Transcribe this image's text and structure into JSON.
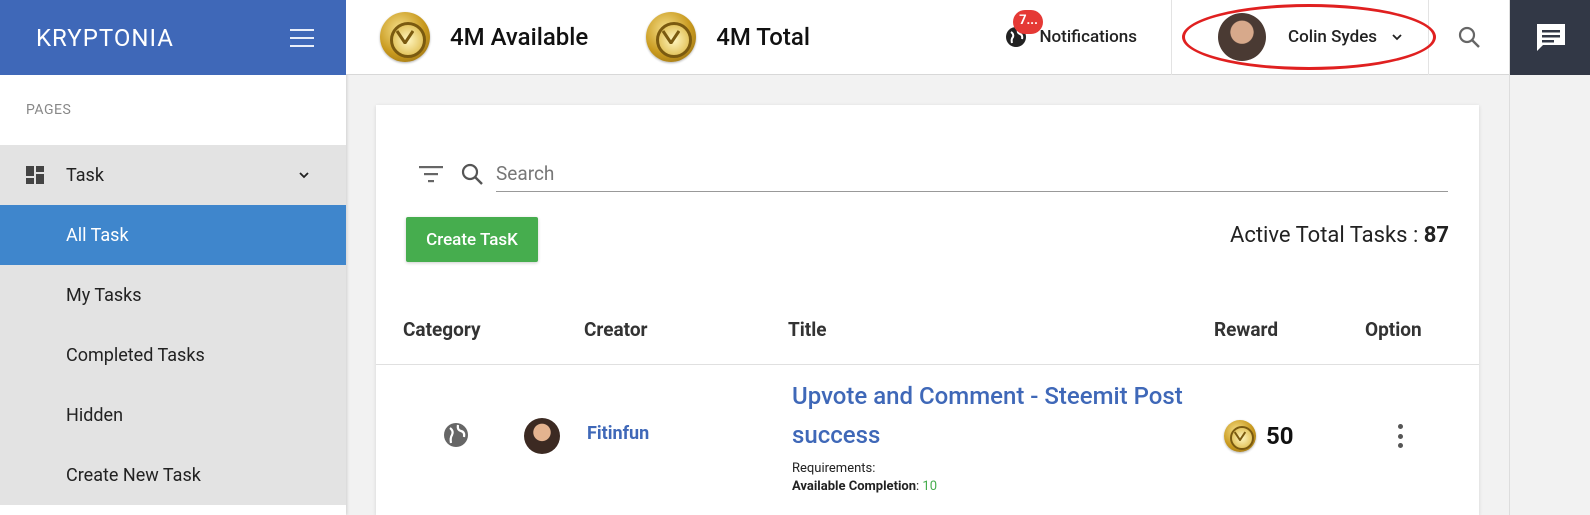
{
  "sidebar": {
    "brand": "KRYPTONIA",
    "section_label": "PAGES",
    "parent_item": {
      "label": "Task",
      "icon": "dashboard-icon"
    },
    "items": [
      {
        "label": "All Task",
        "active": true
      },
      {
        "label": "My Tasks",
        "active": false
      },
      {
        "label": "Completed Tasks",
        "active": false
      },
      {
        "label": "Hidden",
        "active": false
      },
      {
        "label": "Create New Task",
        "active": false
      }
    ]
  },
  "topbar": {
    "available": "4M Available",
    "total": "4M Total",
    "notifications_label": "Notifications",
    "notifications_badge": "7...",
    "user_name": "Colin Sydes"
  },
  "main": {
    "search_placeholder": "Search",
    "create_button": "Create TasK",
    "active_total_label": "Active Total Tasks : ",
    "active_total_value": "87",
    "columns": [
      "Category",
      "Creator",
      "Title",
      "Reward",
      "Option"
    ],
    "row": {
      "creator": "Fitinfun",
      "title": "Upvote and Comment - Steemit Post success",
      "requirements_label": "Requirements:",
      "available_completion_label": "Available Completion",
      "available_completion_value": "10",
      "reward": "50"
    }
  },
  "colors": {
    "brand": "#3f68b8",
    "active_nav": "#3f86cc",
    "create_button": "#46ad4e",
    "badge": "#e53935",
    "highlight_oval": "#e02020"
  }
}
